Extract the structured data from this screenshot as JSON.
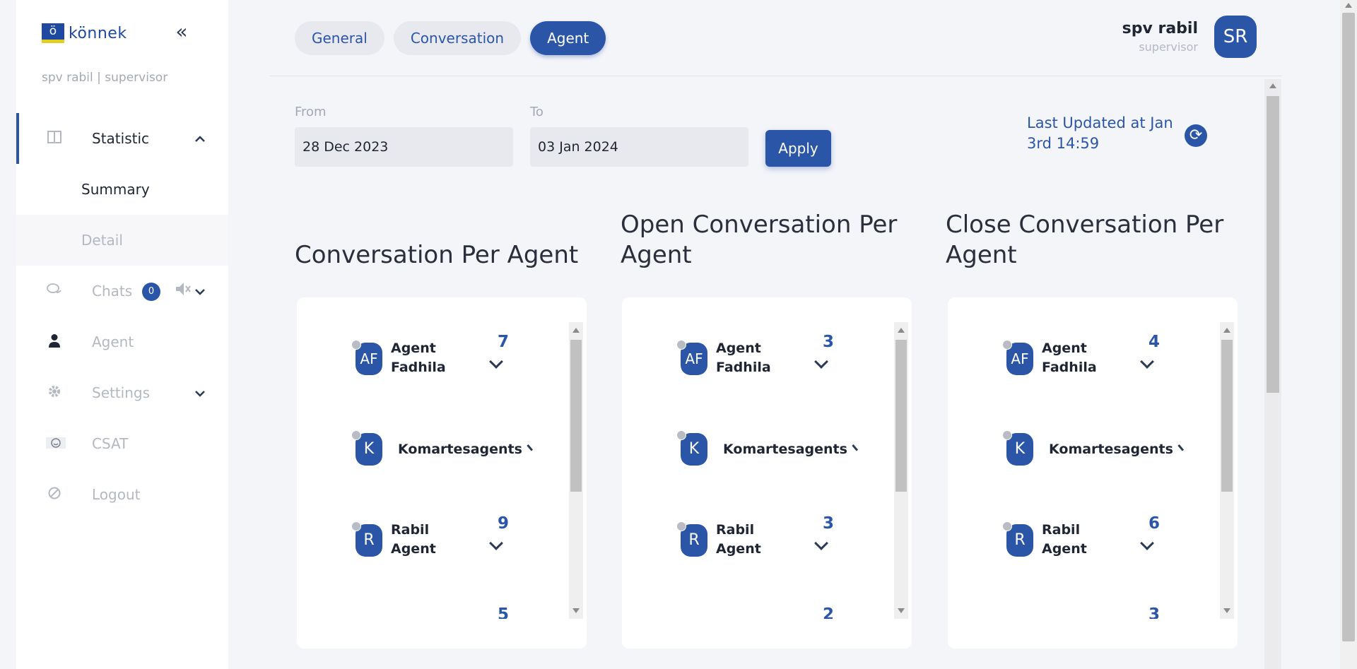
{
  "sidebar": {
    "logo_text": "könnek",
    "logo_mark": "ö",
    "collapse_icon": "«",
    "user_role": "spv rabil | supervisor",
    "statistic": {
      "label": "Statistic",
      "chevron": "⌃"
    },
    "sub_items": [
      {
        "label": "Summary"
      },
      {
        "label": "Detail"
      }
    ],
    "chats": {
      "label": "Chats",
      "badge": "0",
      "mute_icon": "🔇",
      "chevron": "⌄"
    },
    "agent": {
      "label": "Agent"
    },
    "settings": {
      "label": "Settings",
      "chevron": "⌄"
    },
    "csat": {
      "label": "CSAT"
    },
    "logout": {
      "label": "Logout"
    }
  },
  "tabs": [
    {
      "label": "General"
    },
    {
      "label": "Conversation"
    },
    {
      "label": "Agent"
    }
  ],
  "profile": {
    "name": "spv rabil",
    "role": "supervisor",
    "initials": "SR"
  },
  "filters": {
    "from_label": "From",
    "from_value": "28 Dec 2023",
    "to_label": "To",
    "to_value": "03 Jan 2024",
    "apply_label": "Apply",
    "last_updated": "Last Updated at Jan 3rd 14:59",
    "refresh_icon": "⟳"
  },
  "panels": [
    {
      "title": "Conversation Per Agent",
      "agents": [
        {
          "initials": "AF",
          "name_line1": "Agent",
          "name_line2": "Fadhila",
          "count": "7"
        },
        {
          "initials": "K",
          "name_line1": "Komartesagents",
          "name_line2": "",
          "count": ""
        },
        {
          "initials": "R",
          "name_line1": "Rabil",
          "name_line2": "Agent",
          "count": "9"
        },
        {
          "initials": "",
          "name_line1": "",
          "name_line2": "",
          "count": "5"
        }
      ]
    },
    {
      "title": "Open Conversation Per Agent",
      "agents": [
        {
          "initials": "AF",
          "name_line1": "Agent",
          "name_line2": "Fadhila",
          "count": "3"
        },
        {
          "initials": "K",
          "name_line1": "Komartesagents",
          "name_line2": "",
          "count": ""
        },
        {
          "initials": "R",
          "name_line1": "Rabil",
          "name_line2": "Agent",
          "count": "3"
        },
        {
          "initials": "",
          "name_line1": "",
          "name_line2": "",
          "count": "2"
        }
      ]
    },
    {
      "title": "Close Conversation Per Agent",
      "agents": [
        {
          "initials": "AF",
          "name_line1": "Agent",
          "name_line2": "Fadhila",
          "count": "4"
        },
        {
          "initials": "K",
          "name_line1": "Komartesagents",
          "name_line2": "",
          "count": ""
        },
        {
          "initials": "R",
          "name_line1": "Rabil",
          "name_line2": "Agent",
          "count": "6"
        },
        {
          "initials": "",
          "name_line1": "",
          "name_line2": "",
          "count": "3"
        }
      ]
    }
  ],
  "colors": {
    "accent": "#2b56a8",
    "muted": "#b4b8c2",
    "background": "#f4f5f9"
  }
}
